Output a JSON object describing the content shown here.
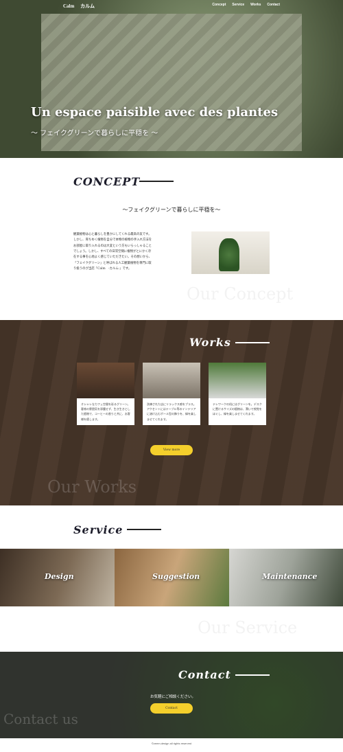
{
  "header": {
    "logo": "Calm　 カルム",
    "nav": [
      "Concept",
      "Service",
      "Works",
      "Contact"
    ]
  },
  "hero": {
    "title": "Un espace paisible avec des plantes",
    "subtitle": "〜 フェイクグリーンで暮らしに平穏を 〜",
    "image": "〔Potted succulents in a hanging bamboo basket (hero photo)〕"
  },
  "concept": {
    "heading": "CONCEPT",
    "subheading": "〜フェイクグリーンで暮らしに平穏を〜",
    "body": "観葉植物は心と暮らしを豊かにしてくれる最高の友です。しかし、育ちゆく植物を自分で本物の植物の手入れ方法をお部屋に取り入れるのは大変という方もいらっしゃることでしょう。しかし、すべての日常空間に植物がとにかく存在する事を心地よく感じていただきたい。その想いから、「フェイクグリーン」と呼ばれる人工観葉植物を専門に取り扱うのが当店「Calm　-カルム-」です。",
    "image": "〔Green plants on a windowsill in a room〕",
    "bg_word": "Our Concept"
  },
  "works": {
    "heading": "Works",
    "cards": [
      {
        "text": "オシャレなカフェ空間を彩るグリーン。客席の雰囲気を邪魔せず、生き生きとした植物で、コーヒーの香りと共に、お客様を癒します。",
        "image": "〔Cafe interior with plants〕"
      },
      {
        "text": "洗練された店にリラックス感をプラス。アクセントにはテーブル等のインテリアに溶け込むボール型の飾りを、緑を楽しませてくれます。",
        "image": "〔Table with small potted plant〕"
      },
      {
        "text": "テレワークの机にはグリーンを。デスクに置けるサイズの植物は、潤いで視覚をほぐし、緑を楽しませてくれます。",
        "image": "〔Laptop with small plants on desk〕"
      }
    ],
    "button": "View more",
    "bg_word": "Our Works"
  },
  "service": {
    "heading": "Service",
    "tiles": [
      {
        "label": "Design",
        "image": "〔Shop shelves with goods〕"
      },
      {
        "label": "Suggestion",
        "image": "〔Books and plant by window〕"
      },
      {
        "label": "Maintenance",
        "image": "〔Glass vessels and succulents〕"
      }
    ],
    "bg_word": "Our Service"
  },
  "contact": {
    "heading": "Contact",
    "message": "お気軽にご相談ください。",
    "button": "Contact",
    "bg_word": "Contact us"
  },
  "footer": {
    "copyright": "©zeem.design all rights reserved"
  }
}
